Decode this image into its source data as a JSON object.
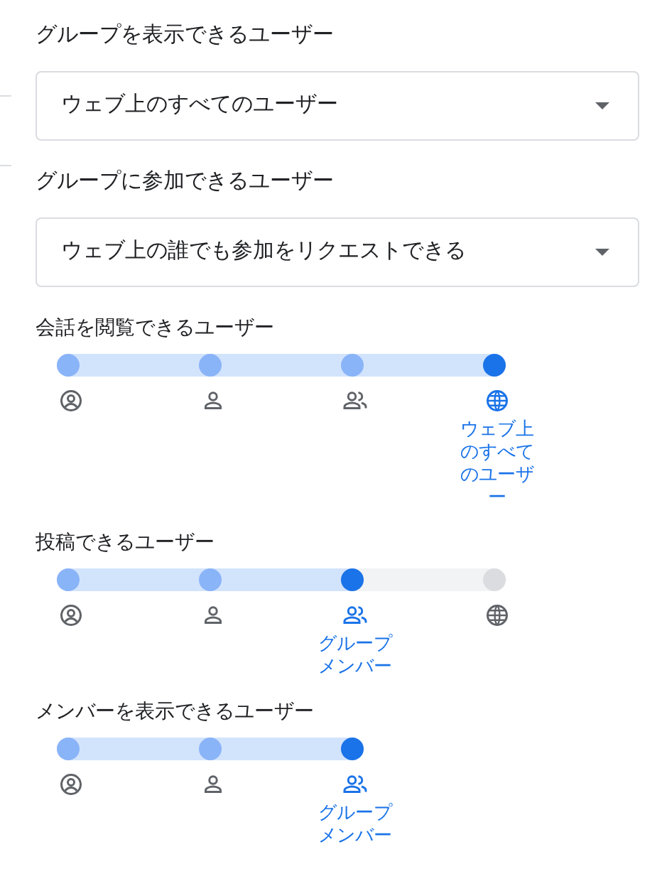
{
  "dropdowns": [
    {
      "label": "グループを表示できるユーザー",
      "value": "ウェブ上のすべてのユーザー"
    },
    {
      "label": "グループに参加できるユーザー",
      "value": "ウェブ上の誰でも参加をリクエストできる"
    }
  ],
  "sliders": [
    {
      "label": "会話を閲覧できるユーザー",
      "steps": [
        {
          "kind": "account",
          "selected": false
        },
        {
          "kind": "person",
          "selected": false
        },
        {
          "kind": "group",
          "selected": false
        },
        {
          "kind": "globe",
          "selected": true,
          "text": "ウェブ上のすべてのユーザー"
        }
      ]
    },
    {
      "label": "投稿できるユーザー",
      "steps": [
        {
          "kind": "account",
          "selected": false
        },
        {
          "kind": "person",
          "selected": false
        },
        {
          "kind": "group",
          "selected": true,
          "text": "グループメンバー"
        },
        {
          "kind": "globe",
          "selected": false
        }
      ]
    },
    {
      "label": "メンバーを表示できるユーザー",
      "steps": [
        {
          "kind": "account",
          "selected": false
        },
        {
          "kind": "person",
          "selected": false
        },
        {
          "kind": "group",
          "selected": true,
          "text": "グループメンバー"
        }
      ]
    }
  ]
}
